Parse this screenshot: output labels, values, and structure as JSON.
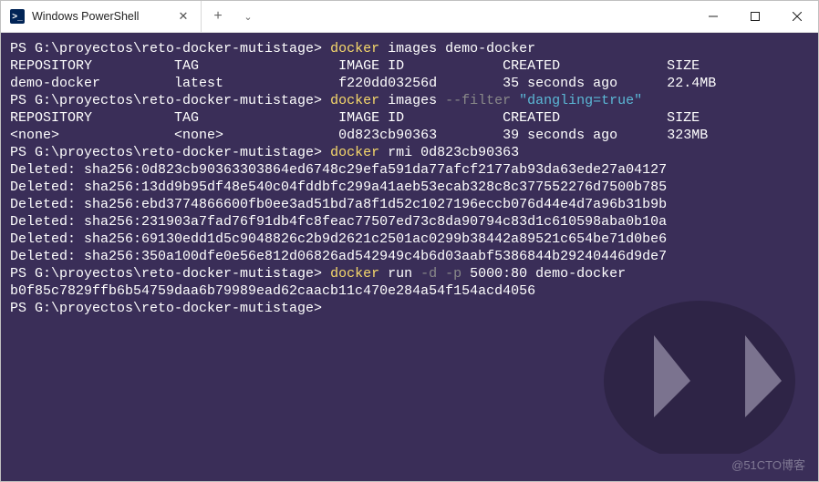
{
  "titlebar": {
    "tab": {
      "icon_text": ">_",
      "label": "Windows PowerShell",
      "close": "✕"
    },
    "new_tab": "+",
    "dropdown": "⌄",
    "controls": {
      "minimize": "—",
      "maximize": "▢",
      "close": "✕"
    }
  },
  "terminal": {
    "prompt_path": "PS G:\\proyectos\\reto-docker-mutistage>",
    "cmd1": {
      "exe": "docker",
      "rest": " images demo-docker"
    },
    "hdr": {
      "repo": "REPOSITORY",
      "tag": "TAG",
      "img": "IMAGE ID",
      "created": "CREATED",
      "size": "SIZE"
    },
    "row1": {
      "repo": "demo-docker",
      "tag": "latest",
      "img": "f220dd03256d",
      "created": "35 seconds ago",
      "size": "22.4MB"
    },
    "cmd2": {
      "exe": "docker",
      "mid": " images ",
      "flag": "--filter",
      "qstr": " \"dangling=true\""
    },
    "row2": {
      "repo": "<none>",
      "tag": "<none>",
      "img": "0d823cb90363",
      "created": "39 seconds ago",
      "size": "323MB"
    },
    "cmd3": {
      "exe": "docker",
      "rest": " rmi 0d823cb90363"
    },
    "deleted": [
      "Deleted: sha256:0d823cb90363303864ed6748c29efa591da77afcf2177ab93da63ede27a04127",
      "Deleted: sha256:13dd9b95df48e540c04fddbfc299a41aeb53ecab328c8c377552276d7500b785",
      "Deleted: sha256:ebd3774866600fb0ee3ad51bd7a8f1d52c1027196eccb076d44e4d7a96b31b9b",
      "Deleted: sha256:231903a7fad76f91db4fc8feac77507ed73c8da90794c83d1c610598aba0b10a",
      "Deleted: sha256:69130edd1d5c9048826c2b9d2621c2501ac0299b38442a89521c654be71d0be6",
      "Deleted: sha256:350a100dfe0e56e812d06826ad542949c4b6d03aabf5386844b29240446d9de7"
    ],
    "cmd4": {
      "exe": "docker",
      "mid": " run ",
      "flag1": "-d",
      "flag2": "-p",
      "rest": " 5000:80 demo-docker"
    },
    "container_id": "b0f85c7829ffb6b54759daa6b79989ead62caacb11c470e284a54f154acd4056",
    "watermark": "@51CTO博客"
  }
}
